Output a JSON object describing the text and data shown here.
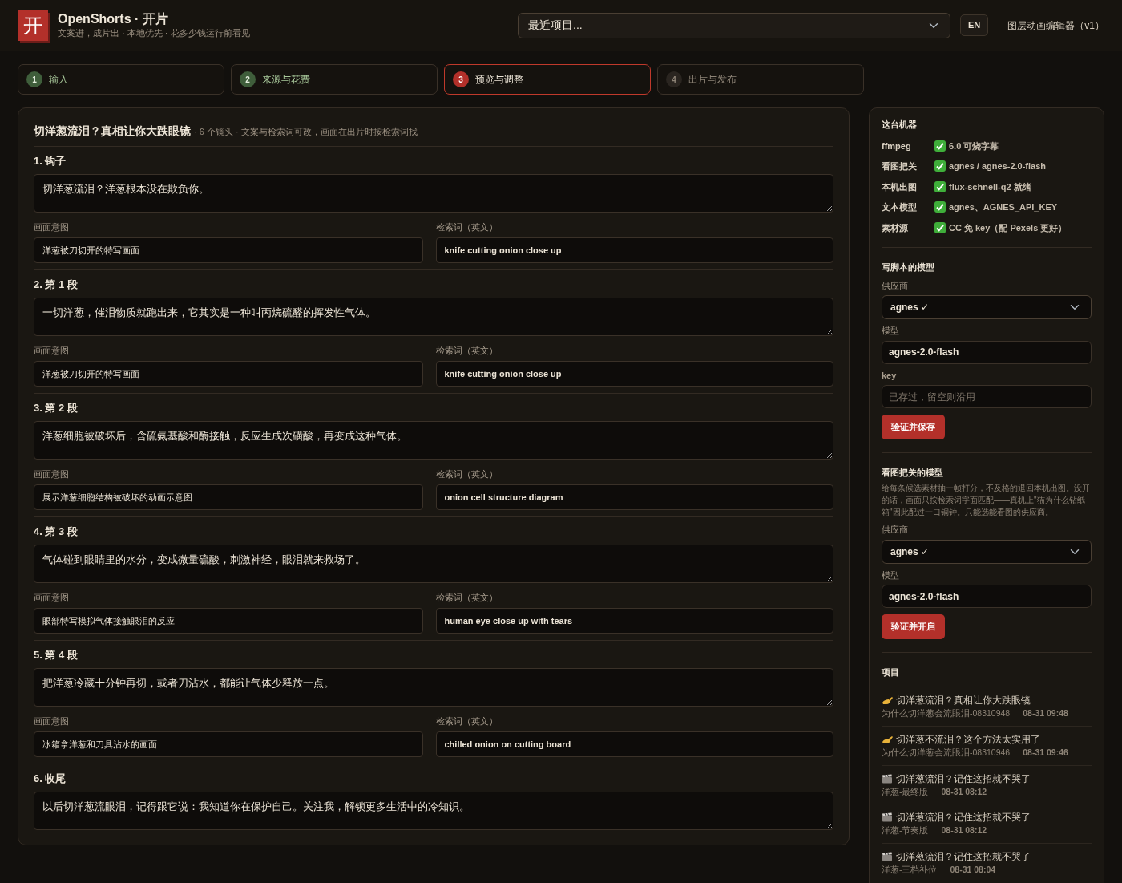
{
  "header": {
    "logo": "开",
    "title": "OpenShorts · 开片",
    "subtitle": "文案进，成片出 · 本地优先 · 花多少钱运行前看见",
    "recent_select": "最近项目...",
    "lang_button": "EN",
    "editor_link": "图层动画编辑器（v1）"
  },
  "steps": [
    {
      "number": "1",
      "label": "输入",
      "done": true,
      "selected": false
    },
    {
      "number": "2",
      "label": "来源与花费",
      "done": true,
      "selected": false
    },
    {
      "number": "3",
      "label": "预览与调整",
      "done": false,
      "selected": true
    },
    {
      "number": "4",
      "label": "出片与发布",
      "done": false,
      "selected": false
    }
  ],
  "script": {
    "title": "切洋葱流泪？真相让你大跌眼镜",
    "meta": "· 6 个镜头 · 文案与检索词可改，画面在出片时按检索词找",
    "shots": [
      {
        "heading": "1. 钩子",
        "text": "切洋葱流泪？洋葱根本没在欺负你。",
        "visual_label": "画面意图",
        "visual": "洋葱被刀切开的特写画面",
        "query_label": "检索词（英文）",
        "query": "knife cutting onion close up"
      },
      {
        "heading": "2. 第 1 段",
        "text": "一切洋葱，催泪物质就跑出来，它其实是一种叫丙烷硫醛的挥发性气体。",
        "visual_label": "画面意图",
        "visual": "洋葱被刀切开的特写画面",
        "query_label": "检索词（英文）",
        "query": "knife cutting onion close up"
      },
      {
        "heading": "3. 第 2 段",
        "text": "洋葱细胞被破坏后，含硫氨基酸和酶接触，反应生成次磺酸，再变成这种气体。",
        "visual_label": "画面意图",
        "visual": "展示洋葱细胞结构被破坏的动画示意图",
        "query_label": "检索词（英文）",
        "query": "onion cell structure diagram"
      },
      {
        "heading": "4. 第 3 段",
        "text": "气体碰到眼睛里的水分，变成微量硫酸，刺激神经，眼泪就来救场了。",
        "visual_label": "画面意图",
        "visual": "眼部特写模拟气体接触眼泪的反应",
        "query_label": "检索词（英文）",
        "query": "human eye close up with tears"
      },
      {
        "heading": "5. 第 4 段",
        "text": "把洋葱冷藏十分钟再切，或者刀沾水，都能让气体少释放一点。",
        "visual_label": "画面意图",
        "visual": "冰箱拿洋葱和刀具沾水的画面",
        "query_label": "检索词（英文）",
        "query": "chilled onion on cutting board"
      },
      {
        "heading": "6. 收尾",
        "text": "以后切洋葱流眼泪，记得跟它说：我知道你在保护自己。关注我，解锁更多生活中的冷知识。"
      }
    ]
  },
  "sidebar": {
    "machine": {
      "title": "这台机器",
      "rows": [
        {
          "name": "ffmpeg",
          "ok": true,
          "value": "6.0 可烧字幕"
        },
        {
          "name": "看图把关",
          "ok": true,
          "value": "agnes / agnes-2.0-flash"
        },
        {
          "name": "本机出图",
          "ok": true,
          "value": "flux-schnell-q2 就绪"
        },
        {
          "name": "文本模型",
          "ok": true,
          "value": "agnes、AGNES_API_KEY"
        },
        {
          "name": "素材源",
          "ok": true,
          "value": "CC 免 key（配 Pexels 更好）"
        }
      ]
    },
    "script_model": {
      "title": "写脚本的模型",
      "provider_label": "供应商",
      "provider": "agnes ✓",
      "model_label": "模型",
      "model": "agnes-2.0-flash",
      "key_label": "key",
      "key_placeholder": "已存过，留空则沿用",
      "button": "验证并保存"
    },
    "vision_model": {
      "title": "看图把关的模型",
      "description": "给每条候选素材抽一帧打分，不及格的退回本机出图。没开的话，画面只按检索词字面匹配——真机上\"猫为什么钻纸箱\"因此配过一口铜钟。只能选能看图的供应商。",
      "provider_label": "供应商",
      "provider": "agnes ✓",
      "model_label": "模型",
      "model": "agnes-2.0-flash",
      "button": "验证并开启"
    },
    "projects": {
      "title": "项目",
      "items": [
        {
          "kind": "draft",
          "title": "切洋葱流泪？真相让你大跌眼镜",
          "name": "为什么切洋葱会流眼泪-08310948",
          "time": "08-31 09:48"
        },
        {
          "kind": "draft",
          "title": "切洋葱不流泪？这个方法太实用了",
          "name": "为什么切洋葱会流眼泪-08310946",
          "time": "08-31 09:46"
        },
        {
          "kind": "video",
          "title": "切洋葱流泪？记住这招就不哭了",
          "name": "洋葱-最终版",
          "time": "08-31 08:12"
        },
        {
          "kind": "video",
          "title": "切洋葱流泪？记住这招就不哭了",
          "name": "洋葱-节奏版",
          "time": "08-31 08:12"
        },
        {
          "kind": "video",
          "title": "切洋葱流泪？记住这招就不哭了",
          "name": "洋葱-三档补位",
          "time": "08-31 08:04"
        }
      ]
    }
  }
}
